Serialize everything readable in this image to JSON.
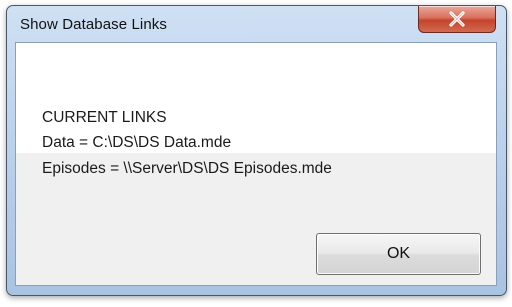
{
  "window": {
    "title": "Show Database Links"
  },
  "message": {
    "heading": "CURRENT LINKS",
    "data_link": "Data = C:\\DS\\DS Data.mde",
    "episodes_link": "Episodes = \\\\Server\\DS\\DS Episodes.mde"
  },
  "buttons": {
    "ok_label": "OK",
    "close_icon": "close-x-icon"
  },
  "colors": {
    "close_button": "#c4442c",
    "titlebar": "#bcd2ec"
  }
}
